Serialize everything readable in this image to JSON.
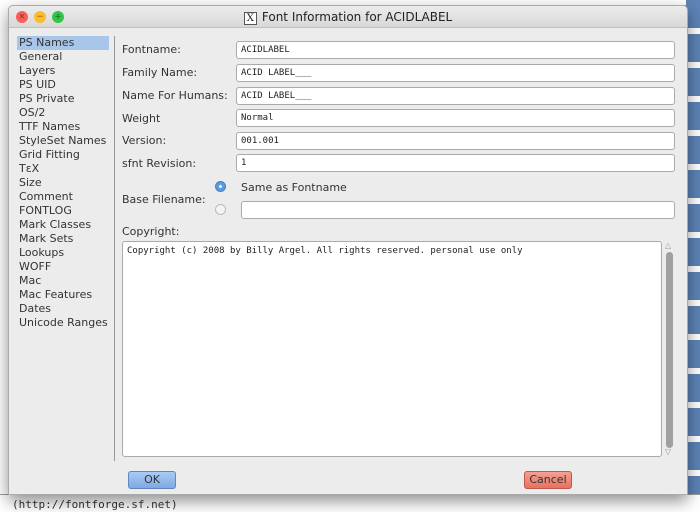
{
  "background": {
    "bottom_text": "(http://fontforge.sf.net)"
  },
  "window": {
    "title": "Font Information for ACIDLABEL",
    "title_icon": "X"
  },
  "sidebar": {
    "items": [
      "PS Names",
      "General",
      "Layers",
      "PS UID",
      "PS Private",
      "OS/2",
      "TTF Names",
      "StyleSet Names",
      "Grid Fitting",
      "TεX",
      "Size",
      "Comment",
      "FONTLOG",
      "Mark Classes",
      "Mark Sets",
      "Lookups",
      "WOFF",
      "Mac",
      "Mac Features",
      "Dates",
      "Unicode Ranges"
    ],
    "selected": "PS Names"
  },
  "form": {
    "fontname": {
      "label": "Fontname:",
      "value": "ACIDLABEL"
    },
    "family": {
      "label": "Family Name:",
      "value": "ACID LABEL___"
    },
    "humans": {
      "label": "Name For Humans:",
      "value": "ACID LABEL___"
    },
    "weight": {
      "label": "Weight",
      "value": "Normal"
    },
    "version": {
      "label": "Version:",
      "value": "001.001"
    },
    "sfnt": {
      "label": "sfnt Revision:",
      "value": "1"
    },
    "base_filename": {
      "label": "Base Filename:",
      "option_same": "Same as Fontname",
      "custom_value": ""
    },
    "copyright": {
      "label": "Copyright:",
      "value": "Copyright (c) 2008 by Billy Argel. All rights reserved. personal use only"
    }
  },
  "buttons": {
    "ok": "OK",
    "cancel": "Cancel"
  },
  "colors": {
    "selection": "#a8c6ea",
    "ok": "#7fa9e0",
    "cancel": "#e8725f"
  }
}
